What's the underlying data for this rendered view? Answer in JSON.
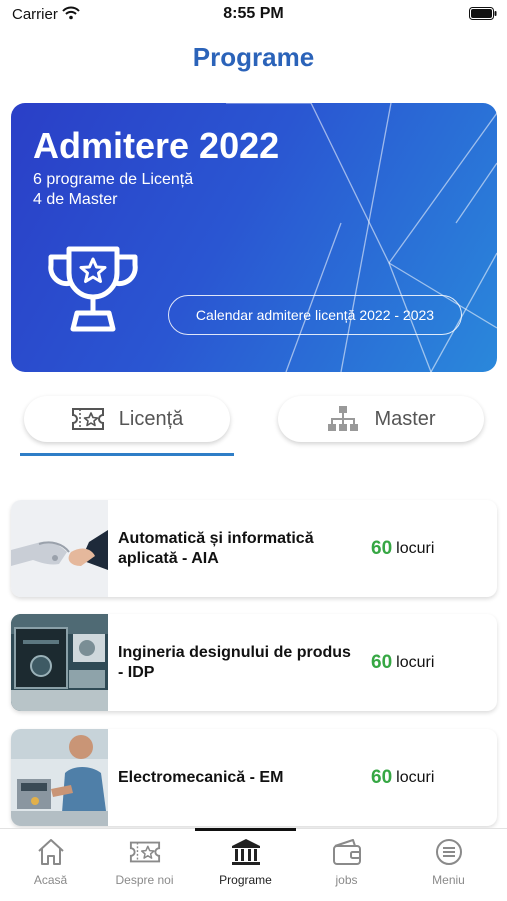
{
  "status": {
    "carrier": "Carrier",
    "time": "8:55 PM"
  },
  "page": {
    "title": "Programe"
  },
  "hero": {
    "title": "Admitere 2022",
    "line1": "6 programe de Licență",
    "line2": "4 de Master",
    "button_label": "Calendar admitere licență 2022 - 2023",
    "colors": {
      "gradient_start": "#2a3fc7",
      "gradient_end": "#2a88db"
    }
  },
  "tabs": [
    {
      "label": "Licență",
      "icon": "ticket-star-icon",
      "selected": true
    },
    {
      "label": "Master",
      "icon": "hierarchy-icon",
      "selected": false
    }
  ],
  "programs": [
    {
      "name": "Automatică și informatică aplicată - AIA",
      "seats": "60",
      "seats_label": "locuri",
      "image": "robot-handshake-photo"
    },
    {
      "name": "Ingineria designului  de produs - IDP",
      "seats": "60",
      "seats_label": "locuri",
      "image": "3d-printer-photo"
    },
    {
      "name": "Electromecanică - EM",
      "seats": "60",
      "seats_label": "locuri",
      "image": "electronics-workshop-photo"
    }
  ],
  "nav": [
    {
      "label": "Acasă",
      "icon": "home-icon"
    },
    {
      "label": "Despre noi",
      "icon": "ticket-star-icon"
    },
    {
      "label": "Programe",
      "icon": "institution-icon",
      "active": true
    },
    {
      "label": "jobs",
      "icon": "wallet-icon"
    },
    {
      "label": "Meniu",
      "icon": "menu-icon"
    }
  ],
  "colors": {
    "accent": "#2b63b9",
    "seats": "#36a744",
    "underline": "#2f7ec7"
  }
}
